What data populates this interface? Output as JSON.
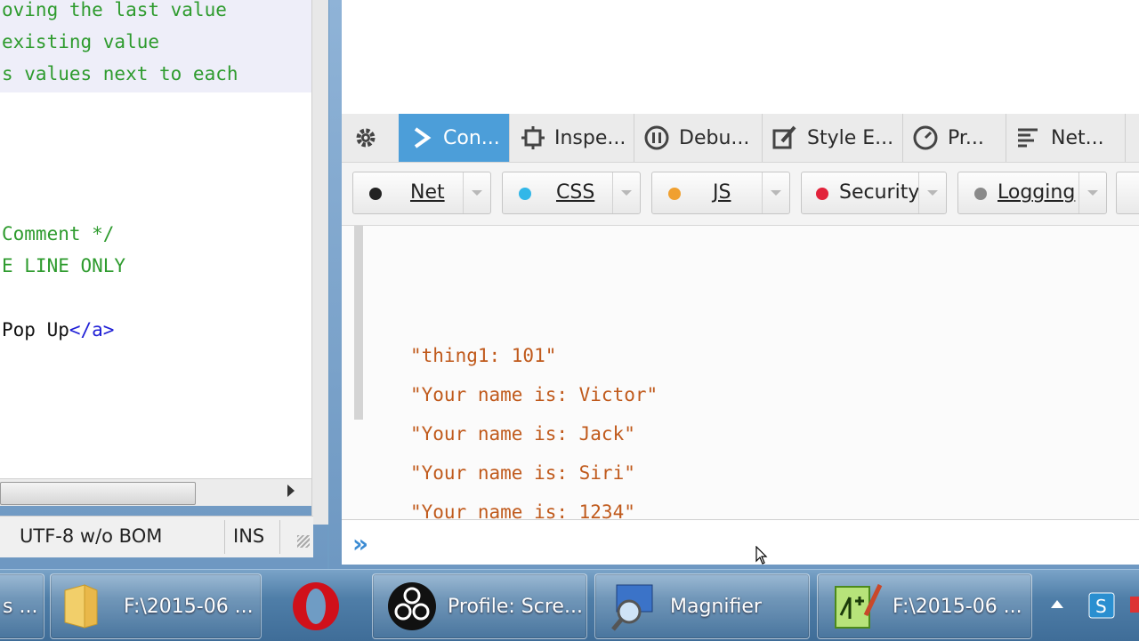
{
  "editor": {
    "lines": [
      {
        "text": "oving the last value",
        "kind": "comment"
      },
      {
        "text": "existing value",
        "kind": "comment"
      },
      {
        "text": "s values next to each",
        "kind": "comment"
      },
      {
        "text": "Comment */",
        "kind": "comment"
      },
      {
        "text": "E LINE ONLY",
        "kind": "comment"
      },
      {
        "text_plain": "Pop Up",
        "text_tag": "</a>",
        "kind": "mixed"
      }
    ],
    "status": {
      "encoding": "UTF-8 w/o BOM",
      "mode": "INS"
    }
  },
  "devtools": {
    "tools": [
      {
        "label": "Con...",
        "icon": "console-icon",
        "active": true
      },
      {
        "label": "Inspe...",
        "icon": "inspector-icon"
      },
      {
        "label": "Debu...",
        "icon": "debugger-icon"
      },
      {
        "label": "Style E...",
        "icon": "style-editor-icon"
      },
      {
        "label": "Pr...",
        "icon": "profiler-icon"
      },
      {
        "label": "Net...",
        "icon": "network-icon"
      }
    ],
    "filters": [
      {
        "label": "Net",
        "dot_color": "#222222"
      },
      {
        "label": "CSS",
        "dot_color": "#32b7e8"
      },
      {
        "label": "JS",
        "dot_color": "#f0a030"
      },
      {
        "label": "Security",
        "dot_color": "#e2233b"
      },
      {
        "label": "Logging",
        "dot_color": "#8a8a8a"
      }
    ],
    "output": [
      "\"thing1: 101\"",
      "\"Your name is: Victor\"",
      "\"Your name is: Jack\"",
      "\"Your name is: Siri\"",
      "\"Your name is: 1234\""
    ],
    "prompt": "»"
  },
  "taskbar": {
    "items": [
      {
        "label": "s ...",
        "icon": "app-icon"
      },
      {
        "label": "F:\\2015-06 ...",
        "icon": "folder-icon"
      },
      {
        "label": "",
        "icon": "opera-icon"
      },
      {
        "label": "Profile: Scre...",
        "icon": "obs-icon"
      },
      {
        "label": "Magnifier",
        "icon": "magnifier-icon"
      },
      {
        "label": "F:\\2015-06 ...",
        "icon": "notepad-plus-icon"
      }
    ],
    "tray": [
      "show-hidden-icons",
      "network-icon"
    ]
  },
  "colors": {
    "accent": "#4c9ed9",
    "log_text": "#c05a1c",
    "comment": "#2e9b2e"
  }
}
